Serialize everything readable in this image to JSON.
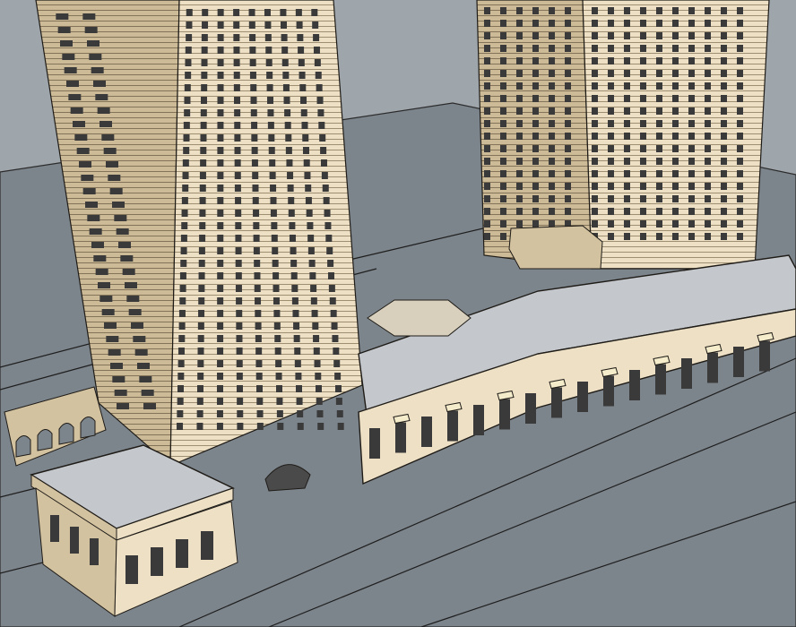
{
  "scene": {
    "colors": {
      "sky": "#9ea5ab",
      "ground": "#7d858c",
      "outline": "#1f1c18",
      "facade_light": "#ede0c4",
      "facade_mid": "#d3c2a0",
      "facade_shadow": "#b7a684",
      "window": "#3b3a3a",
      "roof": "#c4c8cc",
      "awning": "#f5eccb"
    },
    "icons": [
      "tower-left-icon",
      "tower-right-icon",
      "podium-icon",
      "road-icon"
    ]
  }
}
